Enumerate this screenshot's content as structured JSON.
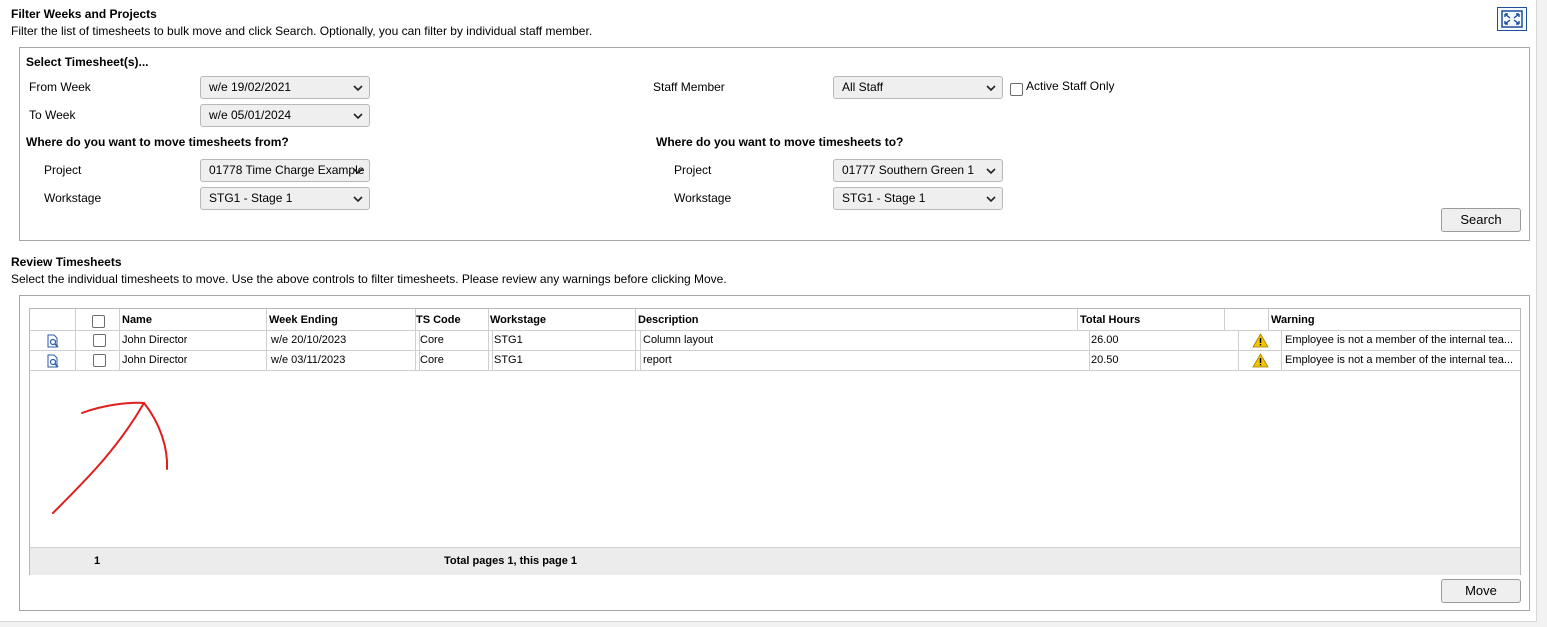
{
  "filter": {
    "title": "Filter Weeks and Projects",
    "description": "Filter the list of timesheets to bulk move and click Search. Optionally, you can filter by individual staff member."
  },
  "select_panel": {
    "title": "Select Timesheet(s)...",
    "from_week_label": "From Week",
    "from_week_value": "w/e 19/02/2021",
    "to_week_label": "To Week",
    "to_week_value": "w/e 05/01/2024",
    "staff_member_label": "Staff Member",
    "staff_member_value": "All Staff",
    "active_staff_only_label": "Active Staff Only",
    "active_staff_only_checked": false,
    "from_heading": "Where do you want to move timesheets from?",
    "from_project_label": "Project",
    "from_project_value": "01778 Time Charge Example",
    "from_workstage_label": "Workstage",
    "from_workstage_value": "STG1 - Stage 1",
    "to_heading": "Where do you want to move timesheets to?",
    "to_project_label": "Project",
    "to_project_value": "01777 Southern Green 1",
    "to_workstage_label": "Workstage",
    "to_workstage_value": "STG1 - Stage 1",
    "search_label": "Search"
  },
  "review": {
    "title": "Review Timesheets",
    "description": "Select the individual timesheets to move. Use the above controls to filter timesheets. Please review any warnings before clicking Move.",
    "columns": {
      "name": "Name",
      "week_ending": "Week Ending",
      "ts_code": "TS Code",
      "workstage": "Workstage",
      "description": "Description",
      "total_hours": "Total Hours",
      "warning": "Warning"
    },
    "rows": [
      {
        "name": "John Director",
        "week_ending": "w/e 20/10/2023",
        "ts_code": "Core",
        "workstage": "STG1",
        "description": "Column layout",
        "total_hours": "26.00",
        "warning": "Employee is not a member of the internal tea..."
      },
      {
        "name": "John Director",
        "week_ending": "w/e 03/11/2023",
        "ts_code": "Core",
        "workstage": "STG1",
        "description": "report",
        "total_hours": "20.50",
        "warning": "Employee is not a member of the internal tea..."
      }
    ],
    "footer": {
      "page_number": "1",
      "pages_text": "Total pages 1, this page 1"
    },
    "move_label": "Move"
  },
  "colors": {
    "accent_blue": "#1f4e9a",
    "annotation_red": "#e01e1e",
    "warning_yellow": "#f5c400"
  },
  "icons": {
    "expand": "expand-arrows-icon",
    "view": "view-document-icon",
    "warning": "warning-triangle-icon",
    "dropdown": "chevron-down-icon"
  }
}
